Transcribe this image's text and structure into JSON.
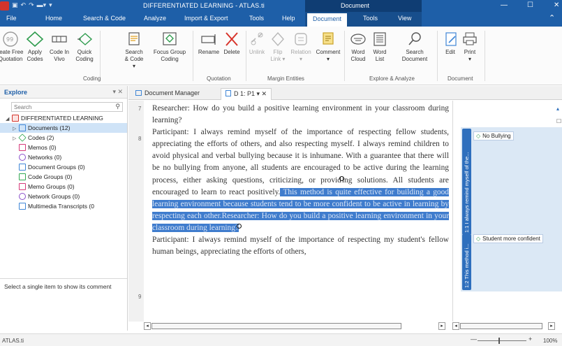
{
  "window": {
    "title": "DIFFERENTIATED LEARNING - ATLAS.ti",
    "context_tab_group": "Document",
    "controls": [
      "minimize-icon",
      "maximize-icon",
      "close-icon"
    ]
  },
  "ribbon": {
    "tabs": [
      "File",
      "Home",
      "Search & Code",
      "Analyze",
      "Import & Export",
      "Tools",
      "Help",
      "Document",
      "Tools",
      "View"
    ],
    "active_tab": "Document",
    "groups": [
      {
        "label": "Coding",
        "buttons": [
          {
            "label": "reate Free\nQuotation",
            "icon": "quotation-icon"
          },
          {
            "label": "Apply\nCodes",
            "icon": "code-diamond-icon"
          },
          {
            "label": "Code In\nVivo",
            "icon": "in-vivo-icon"
          },
          {
            "label": "Quick\nCoding",
            "icon": "quick-coding-icon"
          },
          {
            "label": "Search\n& Code ▾",
            "icon": "search-code-icon"
          },
          {
            "label": "Focus Group\nCoding",
            "icon": "focus-group-icon"
          }
        ]
      },
      {
        "label": "Quotation",
        "buttons": [
          {
            "label": "Rename",
            "icon": "rename-icon"
          },
          {
            "label": "Delete",
            "icon": "delete-x-icon"
          }
        ]
      },
      {
        "label": "Margin Entities",
        "buttons": [
          {
            "label": "Unlink",
            "icon": "unlink-icon"
          },
          {
            "label": "Flip\nLink ▾",
            "icon": "flip-link-icon"
          },
          {
            "label": "Relation\n▾",
            "icon": "relation-icon"
          },
          {
            "label": "Comment\n▾",
            "icon": "comment-icon"
          }
        ]
      },
      {
        "label": "Explore & Analyze",
        "buttons": [
          {
            "label": "Word\nCloud",
            "icon": "word-cloud-icon"
          },
          {
            "label": "Word\nList",
            "icon": "word-list-icon"
          },
          {
            "label": "Search\nDocument",
            "icon": "search-document-icon"
          }
        ]
      },
      {
        "label": "Document",
        "buttons": [
          {
            "label": "Edit",
            "icon": "edit-icon"
          },
          {
            "label": "Print\n▾",
            "icon": "print-icon"
          }
        ]
      }
    ]
  },
  "explore": {
    "title": "Explore",
    "search_placeholder": "Search",
    "project": "DIFFERENTIATED LEARNING",
    "items": [
      {
        "label": "Documents (12)",
        "color": "#3f86d6"
      },
      {
        "label": "Codes (2)",
        "color": "#34a853"
      },
      {
        "label": "Memos (0)",
        "color": "#d63a7a"
      },
      {
        "label": "Networks (0)",
        "color": "#8a4fc9"
      },
      {
        "label": "Document Groups (0)",
        "color": "#3f86d6"
      },
      {
        "label": "Code Groups (0)",
        "color": "#34a853"
      },
      {
        "label": "Memo Groups (0)",
        "color": "#d63a7a"
      },
      {
        "label": "Network Groups (0)",
        "color": "#8a4fc9"
      },
      {
        "label": "Multimedia Transcripts (0",
        "color": "#3f86d6"
      }
    ],
    "footer": "Select a single item to show its comment"
  },
  "document_tabs": [
    {
      "label": "Document Manager"
    },
    {
      "label": "D 1: P1 ▾ ✕"
    }
  ],
  "document": {
    "line_numbers": [
      "7",
      "8",
      "9"
    ],
    "para7": "Researcher: How do you build a positive learning environment in your classroom during learning?",
    "para8_a": "Participant: I always remind myself of the importance of respecting fellow students, appreciating the efforts of others, and also respecting myself. I always remind children to avoid physical and verbal bullying because it is inhumane. With a guarantee that there will be no bullying from anyone, all students are encouraged to be active during the learning process, either asking questions, criticizing, or provid",
    "para8_b": "ing solutions. All students are encouraged to learn to react positively.",
    "para8_hl": " This method is quite effective for building a good learning environment because students tend to be more confident to be active in learning by respecting each other.Researcher: How do you build a positive learning environment in your classroom during learning?",
    "para9": "Participant: I always remind myself of the importance of respecting my student's fellow human beings, appreciating the efforts of others,"
  },
  "margin": {
    "quotes": [
      {
        "label": "1:1 I always remind myself of the...",
        "code": "No Bullying"
      },
      {
        "label": "1:2 This method i...",
        "code": "Student more confident"
      }
    ]
  },
  "status": {
    "app": "ATLAS.ti",
    "zoom": "100%",
    "zoom_level_percent": 100
  },
  "colors": {
    "brand": "#1e5fa8",
    "highlight": "#3f7ccd",
    "margin_bar": "#2e6fbd",
    "code_green": "#2f9c4e"
  }
}
